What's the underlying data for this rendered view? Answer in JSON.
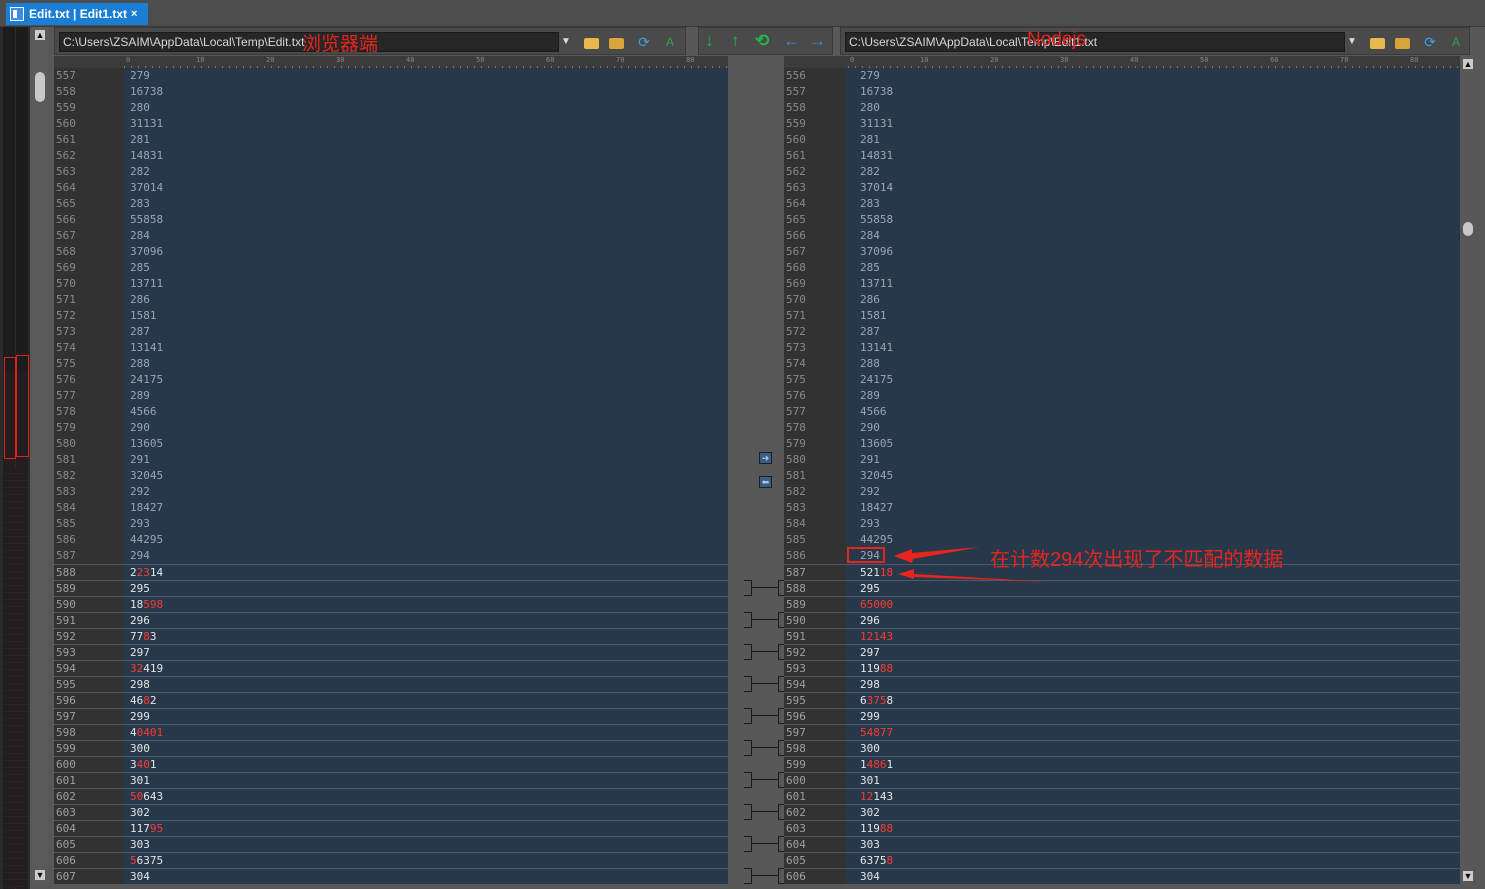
{
  "tab": {
    "title": "Edit.txt | Edit1.txt",
    "close": "×"
  },
  "left": {
    "path": "C:\\Users\\ZSAIM\\AppData\\Local\\Temp\\Edit.txt",
    "overlay_label": "浏览器端",
    "rows": [
      [
        "557",
        "279",
        0
      ],
      [
        "558",
        "16738",
        0
      ],
      [
        "559",
        "280",
        0
      ],
      [
        "560",
        "31131",
        0
      ],
      [
        "561",
        "281",
        0
      ],
      [
        "562",
        "14831",
        0
      ],
      [
        "563",
        "282",
        0
      ],
      [
        "564",
        "37014",
        0
      ],
      [
        "565",
        "283",
        0
      ],
      [
        "566",
        "55858",
        0
      ],
      [
        "567",
        "284",
        0
      ],
      [
        "568",
        "37096",
        0
      ],
      [
        "569",
        "285",
        0
      ],
      [
        "570",
        "13711",
        0
      ],
      [
        "571",
        "286",
        0
      ],
      [
        "572",
        "1581",
        0
      ],
      [
        "573",
        "287",
        0
      ],
      [
        "574",
        "13141",
        0
      ],
      [
        "575",
        "288",
        0
      ],
      [
        "576",
        "24175",
        0
      ],
      [
        "577",
        "289",
        0
      ],
      [
        "578",
        "4566",
        0
      ],
      [
        "579",
        "290",
        0
      ],
      [
        "580",
        "13605",
        0
      ],
      [
        "581",
        "291",
        0
      ],
      [
        "582",
        "32045",
        0
      ],
      [
        "583",
        "292",
        0
      ],
      [
        "584",
        "18427",
        0
      ],
      [
        "585",
        "293",
        0
      ],
      [
        "586",
        "44295",
        0
      ],
      [
        "587",
        "294",
        0
      ],
      [
        "588",
        "22314",
        1
      ],
      [
        "589",
        "295",
        1
      ],
      [
        "590",
        "18598",
        1
      ],
      [
        "591",
        "296",
        1
      ],
      [
        "592",
        "7783",
        1
      ],
      [
        "593",
        "297",
        1
      ],
      [
        "594",
        "32419",
        1
      ],
      [
        "595",
        "298",
        1
      ],
      [
        "596",
        "4682",
        1
      ],
      [
        "597",
        "299",
        1
      ],
      [
        "598",
        "40401",
        1
      ],
      [
        "599",
        "300",
        1
      ],
      [
        "600",
        "3401",
        1
      ],
      [
        "601",
        "301",
        1
      ],
      [
        "602",
        "50643",
        1
      ],
      [
        "603",
        "302",
        1
      ],
      [
        "604",
        "11795",
        1
      ],
      [
        "605",
        "303",
        1
      ],
      [
        "606",
        "56375",
        1
      ],
      [
        "607",
        "304",
        1
      ]
    ]
  },
  "right": {
    "path": "C:\\Users\\ZSAIM\\AppData\\Local\\Temp\\Edit1.txt",
    "overlay_label": "Nodejs",
    "rows": [
      [
        "556",
        "279",
        0
      ],
      [
        "557",
        "16738",
        0
      ],
      [
        "558",
        "280",
        0
      ],
      [
        "559",
        "31131",
        0
      ],
      [
        "560",
        "281",
        0
      ],
      [
        "561",
        "14831",
        0
      ],
      [
        "562",
        "282",
        0
      ],
      [
        "563",
        "37014",
        0
      ],
      [
        "564",
        "283",
        0
      ],
      [
        "565",
        "55858",
        0
      ],
      [
        "566",
        "284",
        0
      ],
      [
        "567",
        "37096",
        0
      ],
      [
        "568",
        "285",
        0
      ],
      [
        "569",
        "13711",
        0
      ],
      [
        "570",
        "286",
        0
      ],
      [
        "571",
        "1581",
        0
      ],
      [
        "572",
        "287",
        0
      ],
      [
        "573",
        "13141",
        0
      ],
      [
        "574",
        "288",
        0
      ],
      [
        "575",
        "24175",
        0
      ],
      [
        "576",
        "289",
        0
      ],
      [
        "577",
        "4566",
        0
      ],
      [
        "578",
        "290",
        0
      ],
      [
        "579",
        "13605",
        0
      ],
      [
        "580",
        "291",
        0
      ],
      [
        "581",
        "32045",
        0
      ],
      [
        "582",
        "292",
        0
      ],
      [
        "583",
        "18427",
        0
      ],
      [
        "584",
        "293",
        0
      ],
      [
        "585",
        "44295",
        0
      ],
      [
        "586",
        "294",
        0
      ],
      [
        "587",
        "52118",
        1
      ],
      [
        "588",
        "295",
        1
      ],
      [
        "589",
        "65000",
        1
      ],
      [
        "590",
        "296",
        1
      ],
      [
        "591",
        "12143",
        1
      ],
      [
        "592",
        "297",
        1
      ],
      [
        "593",
        "11988",
        1
      ],
      [
        "594",
        "298",
        1
      ],
      [
        "595",
        "63758",
        1
      ],
      [
        "596",
        "299",
        1
      ],
      [
        "597",
        "54877",
        1
      ],
      [
        "598",
        "300",
        1
      ],
      [
        "599",
        "14861",
        1
      ],
      [
        "600",
        "301",
        1
      ],
      [
        "601",
        "12143",
        1
      ],
      [
        "602",
        "302",
        1
      ],
      [
        "603",
        "11988",
        1
      ],
      [
        "604",
        "303",
        1
      ],
      [
        "605",
        "63758",
        1
      ],
      [
        "606",
        "304",
        1
      ]
    ]
  },
  "left_red_digits": {
    "588": [
      1,
      3
    ],
    "590": [
      2,
      5
    ],
    "592": [
      2,
      3
    ],
    "594": [
      0,
      2
    ],
    "596": [
      2,
      3
    ],
    "598": [
      1,
      5
    ],
    "600": [
      1,
      3
    ],
    "602": [
      0,
      2
    ],
    "604": [
      3,
      5
    ],
    "606": [
      0,
      1
    ]
  },
  "right_red_digits": {
    "587": [
      3,
      5
    ],
    "589": [
      0,
      5
    ],
    "591": [
      0,
      5
    ],
    "593": [
      3,
      5
    ],
    "595": [
      1,
      4
    ],
    "597": [
      0,
      5
    ],
    "599": [
      1,
      4
    ],
    "601": [
      0,
      2
    ],
    "603": [
      3,
      5
    ],
    "605": [
      4,
      5
    ]
  },
  "ruler_marks": [
    "0",
    "10",
    "20",
    "30",
    "40",
    "50",
    "60",
    "70",
    "80"
  ],
  "annotation": {
    "text": "在计数294次出现了不匹配的数据"
  },
  "colors": {
    "diff_red": "#ff3a30",
    "annotation_red": "#e8241d",
    "tab_blue": "#1a7fd4",
    "pane_bg": "#27384b"
  }
}
